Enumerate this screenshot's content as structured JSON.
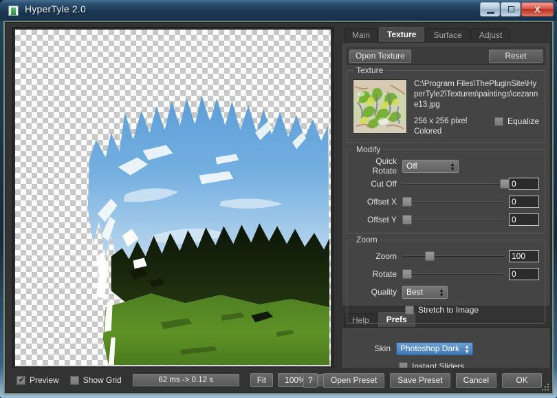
{
  "window": {
    "title": "HyperTyle 2.0",
    "icon": "app-icon",
    "minimize_label": "",
    "maximize_label": "",
    "close_label": "X"
  },
  "preview": {
    "description": "Landscape photo with painterly texture applied, blue sky above dark tree line and green field, on transparency checkerboard"
  },
  "tabs": {
    "main_label": "Main",
    "texture_label": "Texture",
    "surface_label": "Surface",
    "adjust_label": "Adjust",
    "active": "Texture"
  },
  "toolbar": {
    "open_texture_label": "Open Texture",
    "reset_label": "Reset"
  },
  "texture_group": {
    "legend": "Texture",
    "path": "C:\\Program Files\\ThePluginSite\\HyperTyle2\\Textures\\paintings\\cezanne13.jpg",
    "dimensions": "256 x 256 pixel",
    "color_mode": "Colored",
    "equalize_label": "Equalize",
    "equalize_checked": false
  },
  "modify_group": {
    "legend": "Modify",
    "quick_rotate_label": "Quick Rotate",
    "quick_rotate_value": "Off",
    "sliders": [
      {
        "label": "Cut Off",
        "value": "0",
        "pos": 96
      },
      {
        "label": "Offset X",
        "value": "0",
        "pos": 0
      },
      {
        "label": "Offset Y",
        "value": "0",
        "pos": 0
      }
    ]
  },
  "zoom_group": {
    "legend": "Zoom",
    "sliders": [
      {
        "label": "Zoom",
        "value": "100",
        "pos": 22
      },
      {
        "label": "Rotate",
        "value": "0",
        "pos": 0
      }
    ],
    "quality_label": "Quality",
    "quality_value": "Best",
    "stretch_label": "Stretch to Image",
    "stretch_checked": false
  },
  "prefs": {
    "help_tab_label": "Help",
    "prefs_tab_label": "Prefs",
    "active": "Prefs",
    "skin_label": "Skin",
    "skin_value": "Photoshop Dark",
    "instant_sliders_label": "Instant Sliders",
    "instant_sliders_checked": false
  },
  "bottom": {
    "preview_label": "Preview",
    "preview_checked": true,
    "show_grid_label": "Show Grid",
    "show_grid_checked": false,
    "timing": "62 ms -> 0.12 s",
    "fit_label": "Fit",
    "hundred_label": "100%",
    "minus_label": "-",
    "zoom_level": "100%",
    "plus_label": "+",
    "help_label": "?",
    "open_preset_label": "Open Preset",
    "save_preset_label": "Save Preset",
    "cancel_label": "Cancel",
    "ok_label": "OK"
  },
  "colors": {
    "accent": "#3f79b5",
    "panel": "#444444",
    "dialog": "#333333",
    "close_button": "#bb2f24"
  }
}
